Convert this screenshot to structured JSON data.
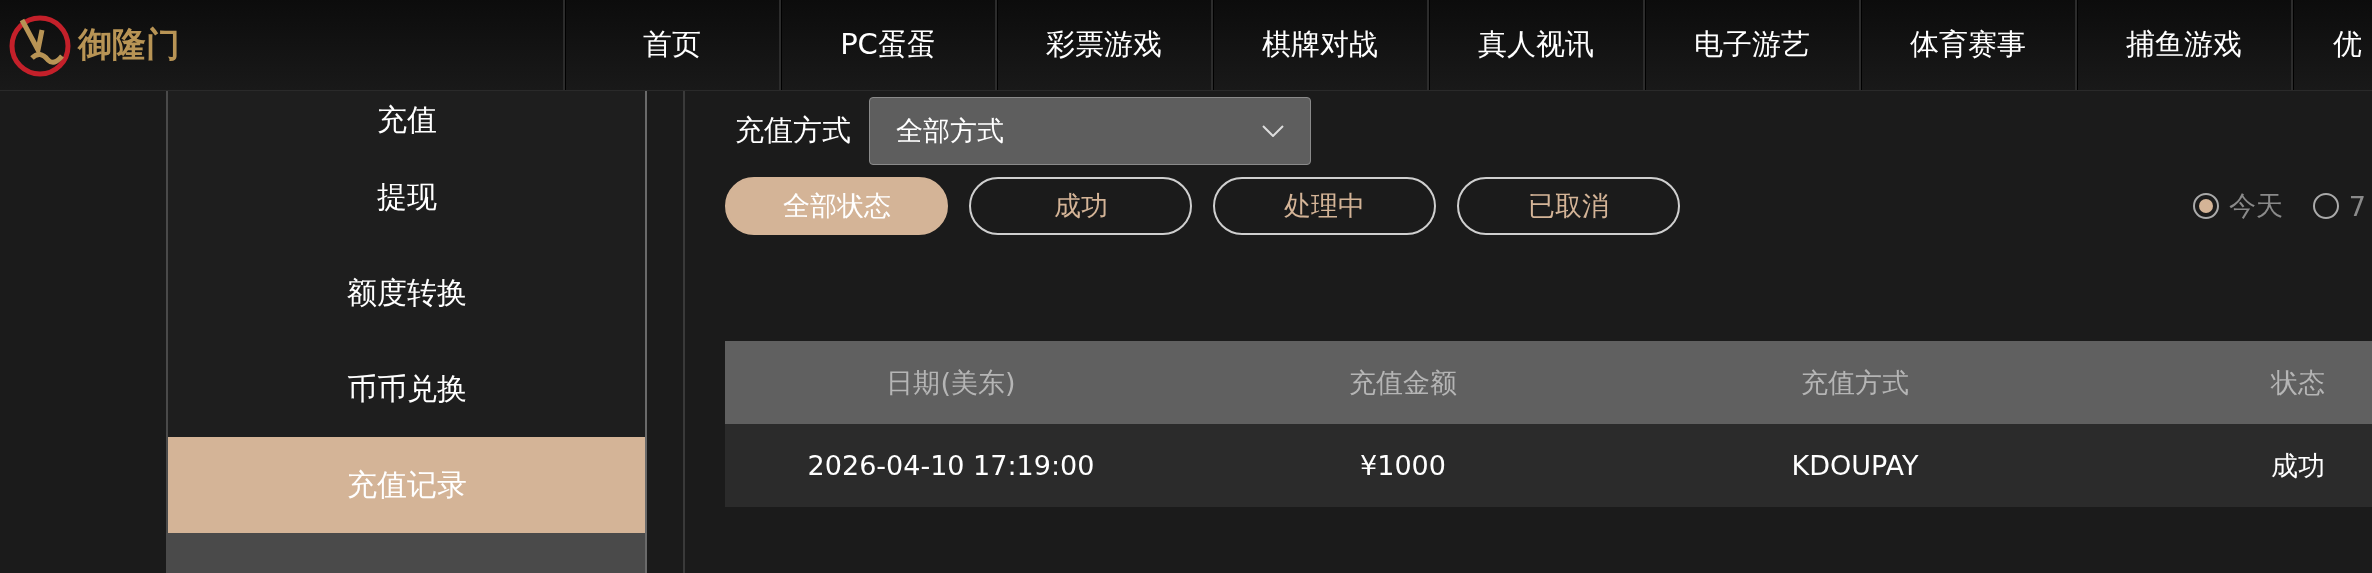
{
  "logo": {
    "text": "御隆门"
  },
  "nav": [
    {
      "label": "首页"
    },
    {
      "label": "PC蛋蛋"
    },
    {
      "label": "彩票游戏"
    },
    {
      "label": "棋牌对战"
    },
    {
      "label": "真人视讯"
    },
    {
      "label": "电子游艺"
    },
    {
      "label": "体育赛事"
    },
    {
      "label": "捕鱼游戏"
    },
    {
      "label": "优"
    }
  ],
  "sidebar": {
    "items": [
      {
        "label": "充值",
        "selected": false
      },
      {
        "label": "提现",
        "selected": false
      },
      {
        "label": "额度转换",
        "selected": false
      },
      {
        "label": "币币兑换",
        "selected": false
      },
      {
        "label": "充值记录",
        "selected": true
      }
    ]
  },
  "filter": {
    "label": "充值方式",
    "select_value": "全部方式"
  },
  "status_buttons": [
    {
      "label": "全部状态",
      "selected": true
    },
    {
      "label": "成功",
      "selected": false
    },
    {
      "label": "处理中",
      "selected": false
    },
    {
      "label": "已取消",
      "selected": false
    }
  ],
  "period_radios": [
    {
      "label": "今天",
      "selected": true
    },
    {
      "label": "7",
      "selected": false
    }
  ],
  "table": {
    "columns": [
      "日期(美东)",
      "充值金额",
      "充值方式",
      "状态"
    ],
    "rows": [
      [
        "2026-04-10 17:19:00",
        "¥1000",
        "KDOUPAY",
        "成功"
      ]
    ]
  }
}
